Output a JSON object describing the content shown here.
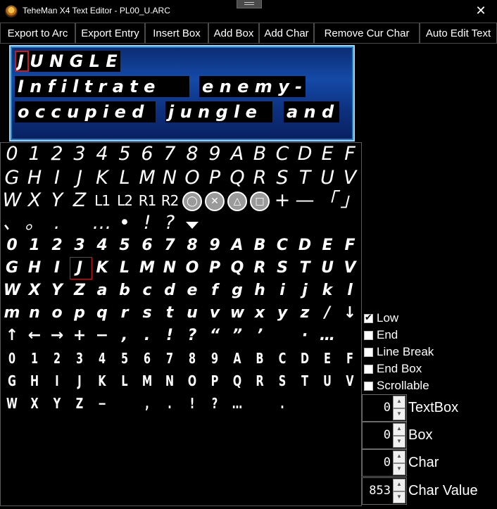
{
  "window": {
    "title": "TeheMan X4 Text Editor - PL00_U.ARC",
    "close_glyph": "✕"
  },
  "toolbar": [
    {
      "label": "Export to Arc"
    },
    {
      "label": "Export Entry"
    },
    {
      "label": "Insert Box"
    },
    {
      "label": "Add Box"
    },
    {
      "label": "Add Char"
    },
    {
      "label": "Remove Cur Char"
    },
    {
      "label": "Auto Edit Text"
    }
  ],
  "preview": {
    "lines": [
      "JUNGLE",
      "Infiltrate enemy-",
      "occupied jungle and"
    ],
    "boxes": [
      {
        "text": "J U N G L E"
      },
      {
        "text": "I n f i l t r a t e"
      },
      {
        "text": "e n e m y -"
      },
      {
        "text": "o c c u p i e d"
      },
      {
        "text": "j u n g l e"
      },
      {
        "text": "a n d"
      }
    ]
  },
  "glyph_rows": [
    [
      "0",
      "1",
      "2",
      "3",
      "4",
      "5",
      "6",
      "7",
      "8",
      "9",
      "A",
      "B",
      "C",
      "D",
      "E",
      "F"
    ],
    [
      "G",
      "H",
      "I",
      "J",
      "K",
      "L",
      "M",
      "N",
      "O",
      "P",
      "Q",
      "R",
      "S",
      "T",
      "U",
      "V"
    ],
    [
      "W",
      "X",
      "Y",
      "Z",
      "L1",
      "L2",
      "R1",
      "R2",
      "◯",
      "✕",
      "△",
      "□",
      "+",
      "—",
      "「",
      "」"
    ],
    [
      "、",
      "。",
      ".",
      "",
      "…",
      "•",
      "!",
      "?",
      "▼",
      "",
      "",
      "",
      "",
      "",
      "",
      ""
    ],
    [
      "0",
      "1",
      "2",
      "3",
      "4",
      "5",
      "6",
      "7",
      "8",
      "9",
      "A",
      "B",
      "C",
      "D",
      "E",
      "F"
    ],
    [
      "G",
      "H",
      "I",
      "J",
      "K",
      "L",
      "M",
      "N",
      "O",
      "P",
      "Q",
      "R",
      "S",
      "T",
      "U",
      "V"
    ],
    [
      "W",
      "X",
      "Y",
      "Z",
      "a",
      "b",
      "c",
      "d",
      "e",
      "f",
      "g",
      "h",
      "i",
      "j",
      "k",
      "l"
    ],
    [
      "m",
      "n",
      "o",
      "p",
      "q",
      "r",
      "s",
      "t",
      "u",
      "v",
      "w",
      "x",
      "y",
      "z",
      "/",
      "↓"
    ],
    [
      "↑",
      "←",
      "→",
      "+",
      "−",
      ",",
      ".",
      "!",
      "?",
      "“",
      "”",
      "’",
      "",
      "·",
      "…",
      ""
    ],
    [
      "0",
      "1",
      "2",
      "3",
      "4",
      "5",
      "6",
      "7",
      "8",
      "9",
      "A",
      "B",
      "C",
      "D",
      "E",
      "F"
    ],
    [
      "G",
      "H",
      "I",
      "J",
      "K",
      "L",
      "M",
      "N",
      "O",
      "P",
      "Q",
      "R",
      "S",
      "T",
      "U",
      "V"
    ],
    [
      "W",
      "X",
      "Y",
      "Z",
      "−",
      "",
      ",",
      ".",
      "!",
      "?",
      "…",
      "",
      ".",
      " ",
      "",
      ""
    ]
  ],
  "options": [
    {
      "label": "Low",
      "checked": true
    },
    {
      "label": "End",
      "checked": false
    },
    {
      "label": "Line Break",
      "checked": false
    },
    {
      "label": "End Box",
      "checked": false
    },
    {
      "label": "Scrollable",
      "checked": false
    }
  ],
  "spinners": [
    {
      "label": "TextBox",
      "value": "0"
    },
    {
      "label": "Box",
      "value": "0"
    },
    {
      "label": "Char",
      "value": "0"
    },
    {
      "label": "Char Value",
      "value": "853"
    }
  ]
}
